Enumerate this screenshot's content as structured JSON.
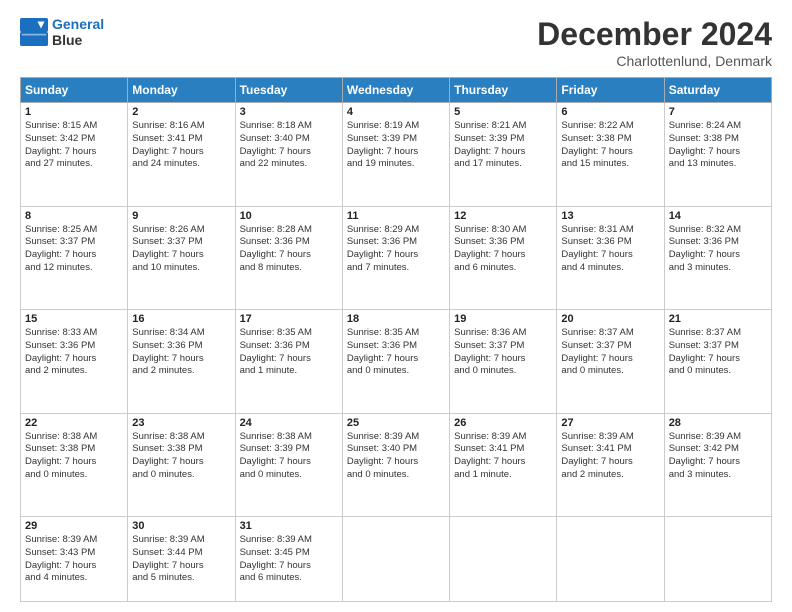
{
  "logo": {
    "line1": "General",
    "line2": "Blue"
  },
  "title": "December 2024",
  "location": "Charlottenlund, Denmark",
  "headers": [
    "Sunday",
    "Monday",
    "Tuesday",
    "Wednesday",
    "Thursday",
    "Friday",
    "Saturday"
  ],
  "weeks": [
    [
      {
        "day": "1",
        "info": "Sunrise: 8:15 AM\nSunset: 3:42 PM\nDaylight: 7 hours\nand 27 minutes."
      },
      {
        "day": "2",
        "info": "Sunrise: 8:16 AM\nSunset: 3:41 PM\nDaylight: 7 hours\nand 24 minutes."
      },
      {
        "day": "3",
        "info": "Sunrise: 8:18 AM\nSunset: 3:40 PM\nDaylight: 7 hours\nand 22 minutes."
      },
      {
        "day": "4",
        "info": "Sunrise: 8:19 AM\nSunset: 3:39 PM\nDaylight: 7 hours\nand 19 minutes."
      },
      {
        "day": "5",
        "info": "Sunrise: 8:21 AM\nSunset: 3:39 PM\nDaylight: 7 hours\nand 17 minutes."
      },
      {
        "day": "6",
        "info": "Sunrise: 8:22 AM\nSunset: 3:38 PM\nDaylight: 7 hours\nand 15 minutes."
      },
      {
        "day": "7",
        "info": "Sunrise: 8:24 AM\nSunset: 3:38 PM\nDaylight: 7 hours\nand 13 minutes."
      }
    ],
    [
      {
        "day": "8",
        "info": "Sunrise: 8:25 AM\nSunset: 3:37 PM\nDaylight: 7 hours\nand 12 minutes."
      },
      {
        "day": "9",
        "info": "Sunrise: 8:26 AM\nSunset: 3:37 PM\nDaylight: 7 hours\nand 10 minutes."
      },
      {
        "day": "10",
        "info": "Sunrise: 8:28 AM\nSunset: 3:36 PM\nDaylight: 7 hours\nand 8 minutes."
      },
      {
        "day": "11",
        "info": "Sunrise: 8:29 AM\nSunset: 3:36 PM\nDaylight: 7 hours\nand 7 minutes."
      },
      {
        "day": "12",
        "info": "Sunrise: 8:30 AM\nSunset: 3:36 PM\nDaylight: 7 hours\nand 6 minutes."
      },
      {
        "day": "13",
        "info": "Sunrise: 8:31 AM\nSunset: 3:36 PM\nDaylight: 7 hours\nand 4 minutes."
      },
      {
        "day": "14",
        "info": "Sunrise: 8:32 AM\nSunset: 3:36 PM\nDaylight: 7 hours\nand 3 minutes."
      }
    ],
    [
      {
        "day": "15",
        "info": "Sunrise: 8:33 AM\nSunset: 3:36 PM\nDaylight: 7 hours\nand 2 minutes."
      },
      {
        "day": "16",
        "info": "Sunrise: 8:34 AM\nSunset: 3:36 PM\nDaylight: 7 hours\nand 2 minutes."
      },
      {
        "day": "17",
        "info": "Sunrise: 8:35 AM\nSunset: 3:36 PM\nDaylight: 7 hours\nand 1 minute."
      },
      {
        "day": "18",
        "info": "Sunrise: 8:35 AM\nSunset: 3:36 PM\nDaylight: 7 hours\nand 0 minutes."
      },
      {
        "day": "19",
        "info": "Sunrise: 8:36 AM\nSunset: 3:37 PM\nDaylight: 7 hours\nand 0 minutes."
      },
      {
        "day": "20",
        "info": "Sunrise: 8:37 AM\nSunset: 3:37 PM\nDaylight: 7 hours\nand 0 minutes."
      },
      {
        "day": "21",
        "info": "Sunrise: 8:37 AM\nSunset: 3:37 PM\nDaylight: 7 hours\nand 0 minutes."
      }
    ],
    [
      {
        "day": "22",
        "info": "Sunrise: 8:38 AM\nSunset: 3:38 PM\nDaylight: 7 hours\nand 0 minutes."
      },
      {
        "day": "23",
        "info": "Sunrise: 8:38 AM\nSunset: 3:38 PM\nDaylight: 7 hours\nand 0 minutes."
      },
      {
        "day": "24",
        "info": "Sunrise: 8:38 AM\nSunset: 3:39 PM\nDaylight: 7 hours\nand 0 minutes."
      },
      {
        "day": "25",
        "info": "Sunrise: 8:39 AM\nSunset: 3:40 PM\nDaylight: 7 hours\nand 0 minutes."
      },
      {
        "day": "26",
        "info": "Sunrise: 8:39 AM\nSunset: 3:41 PM\nDaylight: 7 hours\nand 1 minute."
      },
      {
        "day": "27",
        "info": "Sunrise: 8:39 AM\nSunset: 3:41 PM\nDaylight: 7 hours\nand 2 minutes."
      },
      {
        "day": "28",
        "info": "Sunrise: 8:39 AM\nSunset: 3:42 PM\nDaylight: 7 hours\nand 3 minutes."
      }
    ],
    [
      {
        "day": "29",
        "info": "Sunrise: 8:39 AM\nSunset: 3:43 PM\nDaylight: 7 hours\nand 4 minutes."
      },
      {
        "day": "30",
        "info": "Sunrise: 8:39 AM\nSunset: 3:44 PM\nDaylight: 7 hours\nand 5 minutes."
      },
      {
        "day": "31",
        "info": "Sunrise: 8:39 AM\nSunset: 3:45 PM\nDaylight: 7 hours\nand 6 minutes."
      },
      null,
      null,
      null,
      null
    ]
  ]
}
